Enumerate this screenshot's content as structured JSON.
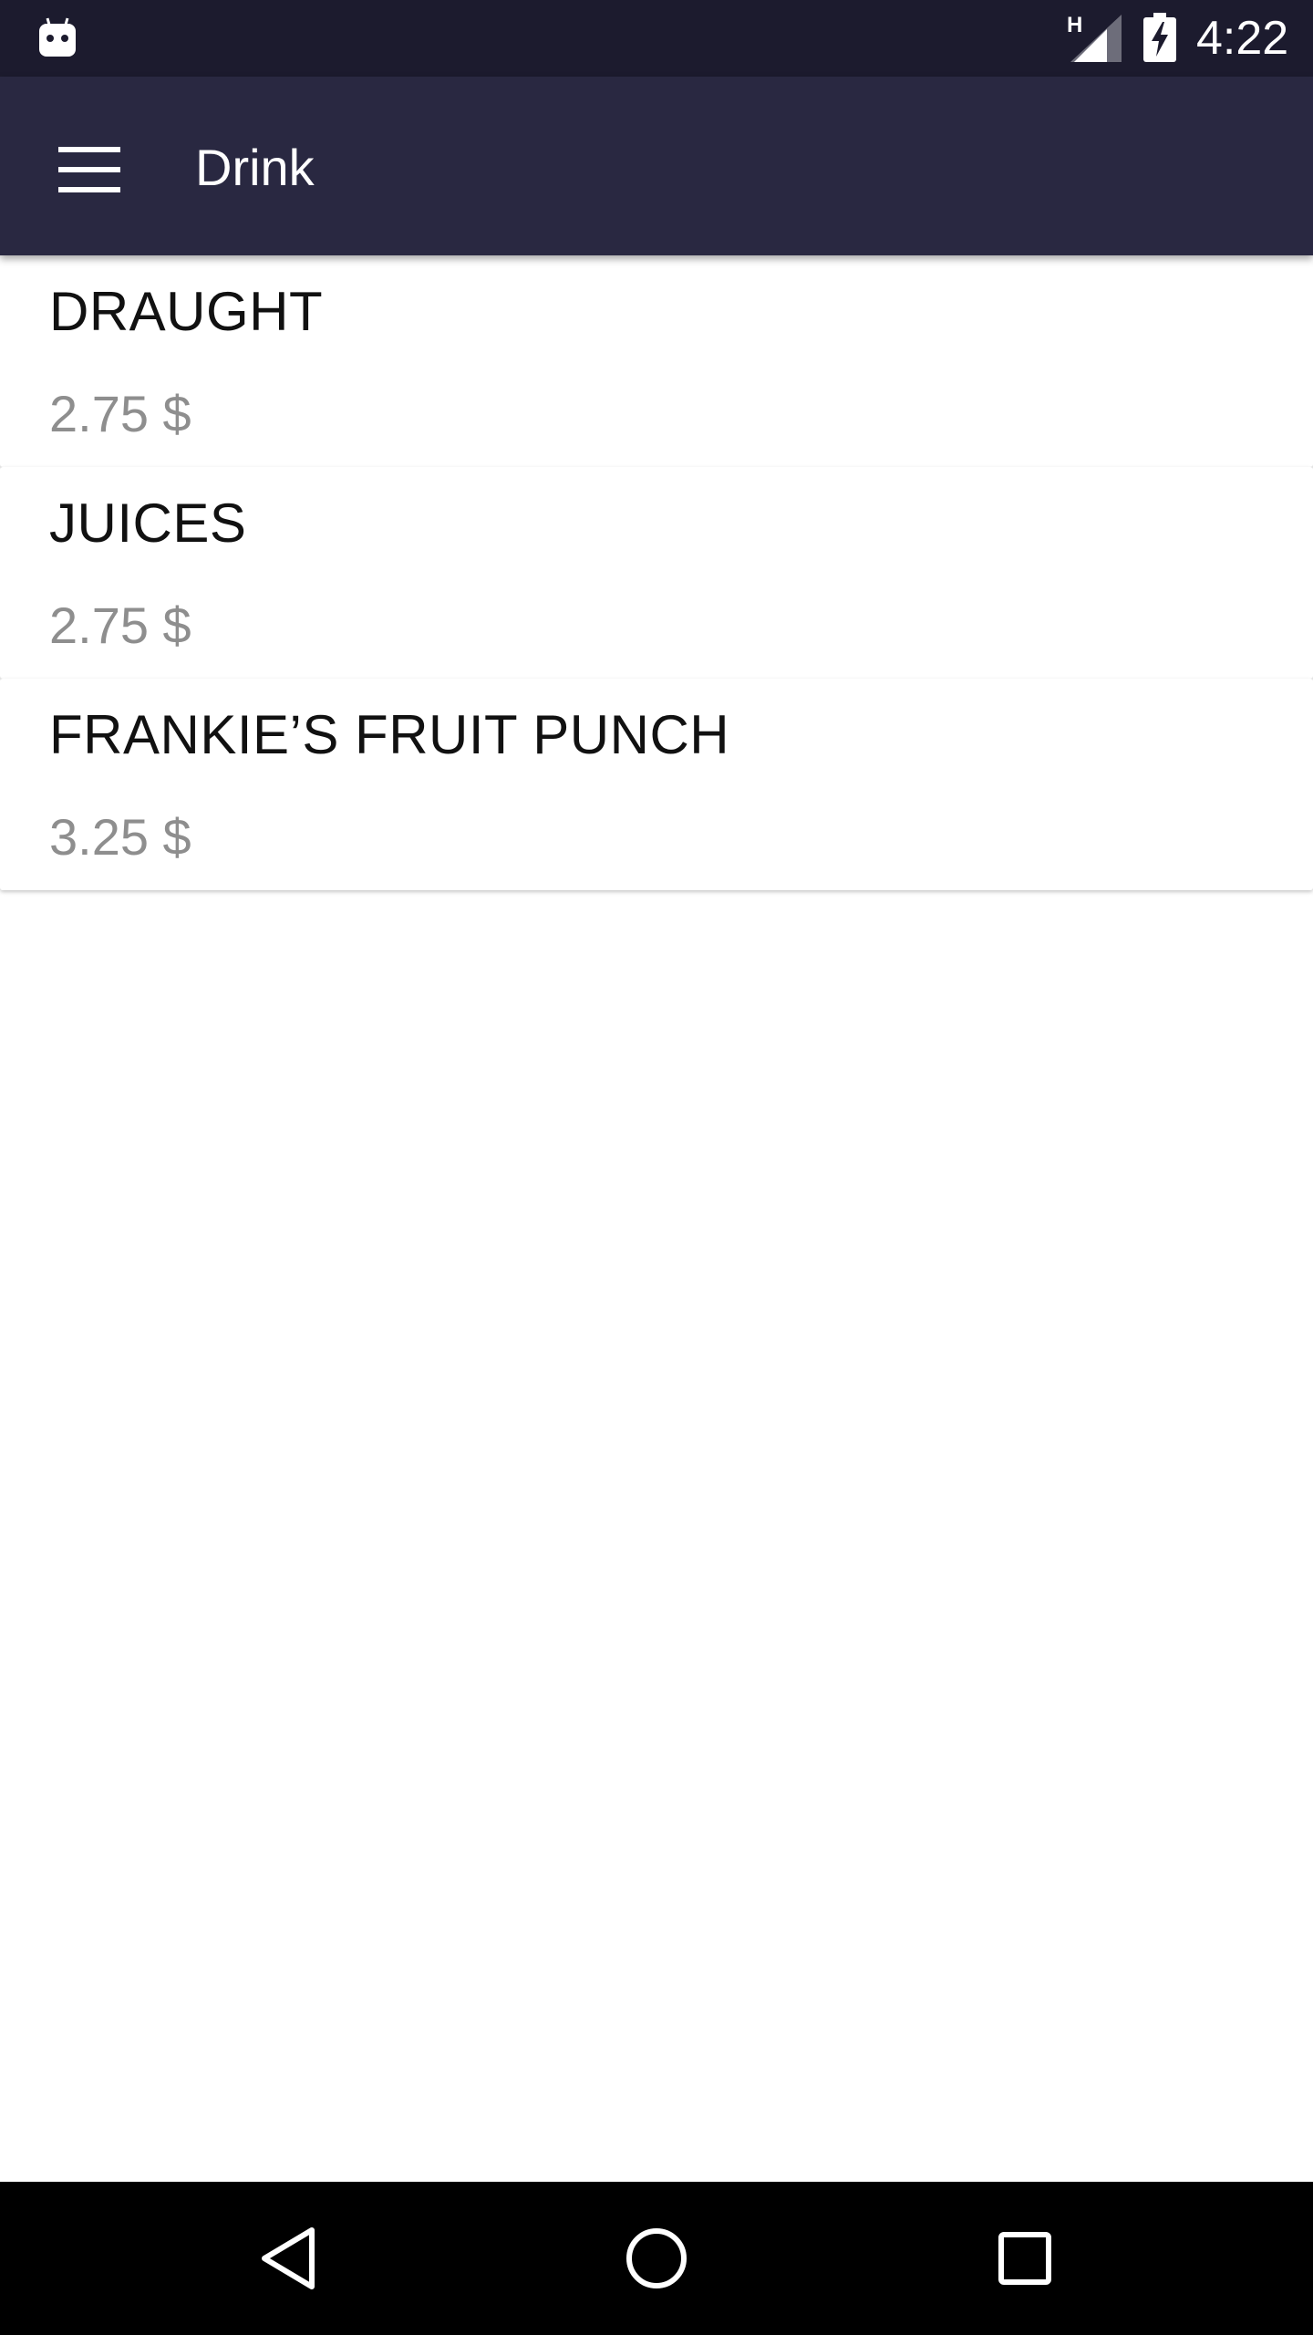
{
  "status_bar": {
    "network_type": "H",
    "time": "4:22",
    "icons": [
      "android-notification-icon",
      "signal-icon",
      "battery-charging-icon"
    ]
  },
  "app_bar": {
    "title": "Drink",
    "menu_icon": "hamburger-menu-icon"
  },
  "items": [
    {
      "name": "DRAUGHT",
      "price": "2.75 $"
    },
    {
      "name": "JUICES",
      "price": "2.75 $"
    },
    {
      "name": "FRANKIE’S FRUIT PUNCH",
      "price": "3.25 $"
    }
  ],
  "nav_bar": {
    "icons": [
      "back-icon",
      "home-icon",
      "recents-icon"
    ]
  },
  "colors": {
    "status_bar": "#1c1b2e",
    "app_bar": "#292841",
    "price_text": "#8e8e8e",
    "nav_bar": "#000000"
  }
}
